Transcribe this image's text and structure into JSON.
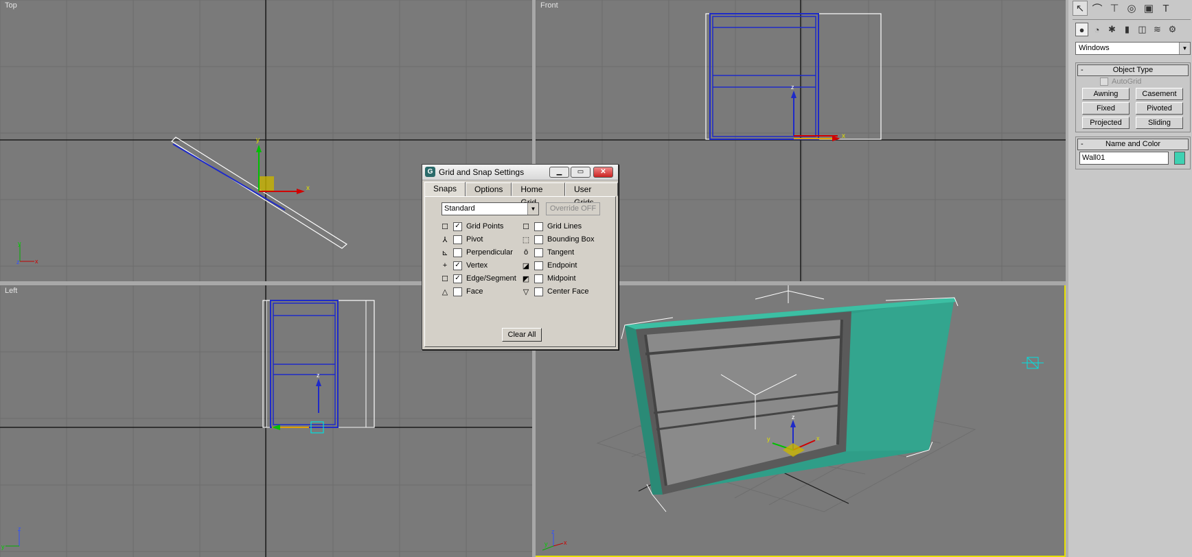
{
  "viewports": {
    "top": "Top",
    "front": "Front",
    "left": "Left"
  },
  "axes": {
    "x": "x",
    "y": "y",
    "z": "z"
  },
  "panel": {
    "tab_icons": [
      "select-icon",
      "arc-icon",
      "hierarchy-icon",
      "motion-icon",
      "display-icon",
      "hammer-icon"
    ],
    "category_icons": [
      "geometry-icon",
      "shapes-icon",
      "lights-icon",
      "cameras-icon",
      "helpers-icon",
      "spacewarps-icon",
      "systems-icon"
    ],
    "category_select": "Windows",
    "object_type": {
      "title": "Object Type",
      "collapse": "-",
      "autogrid": "AutoGrid",
      "buttons": [
        "Awning",
        "Casement",
        "Fixed",
        "Pivoted",
        "Projected",
        "Sliding"
      ]
    },
    "name_color": {
      "title": "Name and Color",
      "collapse": "-",
      "name": "Wall01",
      "color": "#3fd1b2"
    }
  },
  "dialog": {
    "title": "Grid and Snap Settings",
    "min": "▁",
    "max": "▭",
    "close": "✕",
    "tabs": [
      "Snaps",
      "Options",
      "Home Grid",
      "User Grids"
    ],
    "preset": "Standard",
    "override": "Override OFF",
    "left_snaps": [
      {
        "label": "Grid Points",
        "checked": true,
        "sym": "☐"
      },
      {
        "label": "Pivot",
        "checked": false,
        "sym": "⅄"
      },
      {
        "label": "Perpendicular",
        "checked": false,
        "sym": "⊾"
      },
      {
        "label": "Vertex",
        "checked": true,
        "sym": "+"
      },
      {
        "label": "Edge/Segment",
        "checked": true,
        "sym": "☐"
      },
      {
        "label": "Face",
        "checked": false,
        "sym": "△"
      }
    ],
    "right_snaps": [
      {
        "label": "Grid Lines",
        "checked": false,
        "sym": "☐"
      },
      {
        "label": "Bounding Box",
        "checked": false,
        "sym": "⬚"
      },
      {
        "label": "Tangent",
        "checked": false,
        "sym": "ō"
      },
      {
        "label": "Endpoint",
        "checked": false,
        "sym": "◪"
      },
      {
        "label": "Midpoint",
        "checked": false,
        "sym": "◩"
      },
      {
        "label": "Center Face",
        "checked": false,
        "sym": "▽"
      }
    ],
    "clear_all": "Clear All"
  }
}
